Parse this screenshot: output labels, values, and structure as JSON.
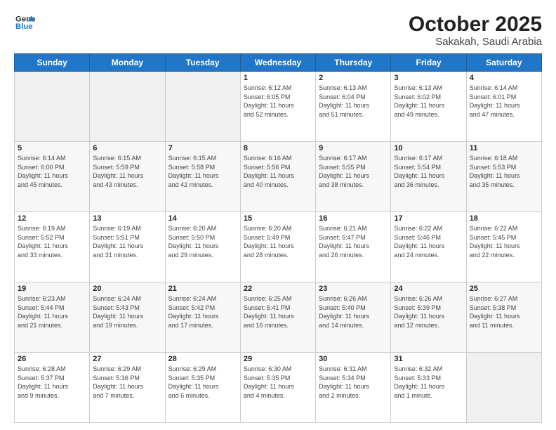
{
  "header": {
    "logo_general": "General",
    "logo_blue": "Blue",
    "month": "October 2025",
    "location": "Sakakah, Saudi Arabia"
  },
  "weekdays": [
    "Sunday",
    "Monday",
    "Tuesday",
    "Wednesday",
    "Thursday",
    "Friday",
    "Saturday"
  ],
  "weeks": [
    [
      {
        "date": "",
        "info": ""
      },
      {
        "date": "",
        "info": ""
      },
      {
        "date": "",
        "info": ""
      },
      {
        "date": "1",
        "info": "Sunrise: 6:12 AM\nSunset: 6:05 PM\nDaylight: 11 hours\nand 52 minutes."
      },
      {
        "date": "2",
        "info": "Sunrise: 6:13 AM\nSunset: 6:04 PM\nDaylight: 11 hours\nand 51 minutes."
      },
      {
        "date": "3",
        "info": "Sunrise: 6:13 AM\nSunset: 6:02 PM\nDaylight: 11 hours\nand 49 minutes."
      },
      {
        "date": "4",
        "info": "Sunrise: 6:14 AM\nSunset: 6:01 PM\nDaylight: 11 hours\nand 47 minutes."
      }
    ],
    [
      {
        "date": "5",
        "info": "Sunrise: 6:14 AM\nSunset: 6:00 PM\nDaylight: 11 hours\nand 45 minutes."
      },
      {
        "date": "6",
        "info": "Sunrise: 6:15 AM\nSunset: 5:59 PM\nDaylight: 11 hours\nand 43 minutes."
      },
      {
        "date": "7",
        "info": "Sunrise: 6:15 AM\nSunset: 5:58 PM\nDaylight: 11 hours\nand 42 minutes."
      },
      {
        "date": "8",
        "info": "Sunrise: 6:16 AM\nSunset: 5:56 PM\nDaylight: 11 hours\nand 40 minutes."
      },
      {
        "date": "9",
        "info": "Sunrise: 6:17 AM\nSunset: 5:55 PM\nDaylight: 11 hours\nand 38 minutes."
      },
      {
        "date": "10",
        "info": "Sunrise: 6:17 AM\nSunset: 5:54 PM\nDaylight: 11 hours\nand 36 minutes."
      },
      {
        "date": "11",
        "info": "Sunrise: 6:18 AM\nSunset: 5:53 PM\nDaylight: 11 hours\nand 35 minutes."
      }
    ],
    [
      {
        "date": "12",
        "info": "Sunrise: 6:19 AM\nSunset: 5:52 PM\nDaylight: 11 hours\nand 33 minutes."
      },
      {
        "date": "13",
        "info": "Sunrise: 6:19 AM\nSunset: 5:51 PM\nDaylight: 11 hours\nand 31 minutes."
      },
      {
        "date": "14",
        "info": "Sunrise: 6:20 AM\nSunset: 5:50 PM\nDaylight: 11 hours\nand 29 minutes."
      },
      {
        "date": "15",
        "info": "Sunrise: 6:20 AM\nSunset: 5:49 PM\nDaylight: 11 hours\nand 28 minutes."
      },
      {
        "date": "16",
        "info": "Sunrise: 6:21 AM\nSunset: 5:47 PM\nDaylight: 11 hours\nand 26 minutes."
      },
      {
        "date": "17",
        "info": "Sunrise: 6:22 AM\nSunset: 5:46 PM\nDaylight: 11 hours\nand 24 minutes."
      },
      {
        "date": "18",
        "info": "Sunrise: 6:22 AM\nSunset: 5:45 PM\nDaylight: 11 hours\nand 22 minutes."
      }
    ],
    [
      {
        "date": "19",
        "info": "Sunrise: 6:23 AM\nSunset: 5:44 PM\nDaylight: 11 hours\nand 21 minutes."
      },
      {
        "date": "20",
        "info": "Sunrise: 6:24 AM\nSunset: 5:43 PM\nDaylight: 11 hours\nand 19 minutes."
      },
      {
        "date": "21",
        "info": "Sunrise: 6:24 AM\nSunset: 5:42 PM\nDaylight: 11 hours\nand 17 minutes."
      },
      {
        "date": "22",
        "info": "Sunrise: 6:25 AM\nSunset: 5:41 PM\nDaylight: 11 hours\nand 16 minutes."
      },
      {
        "date": "23",
        "info": "Sunrise: 6:26 AM\nSunset: 5:40 PM\nDaylight: 11 hours\nand 14 minutes."
      },
      {
        "date": "24",
        "info": "Sunrise: 6:26 AM\nSunset: 5:39 PM\nDaylight: 11 hours\nand 12 minutes."
      },
      {
        "date": "25",
        "info": "Sunrise: 6:27 AM\nSunset: 5:38 PM\nDaylight: 11 hours\nand 11 minutes."
      }
    ],
    [
      {
        "date": "26",
        "info": "Sunrise: 6:28 AM\nSunset: 5:37 PM\nDaylight: 11 hours\nand 9 minutes."
      },
      {
        "date": "27",
        "info": "Sunrise: 6:29 AM\nSunset: 5:36 PM\nDaylight: 11 hours\nand 7 minutes."
      },
      {
        "date": "28",
        "info": "Sunrise: 6:29 AM\nSunset: 5:35 PM\nDaylight: 11 hours\nand 6 minutes."
      },
      {
        "date": "29",
        "info": "Sunrise: 6:30 AM\nSunset: 5:35 PM\nDaylight: 11 hours\nand 4 minutes."
      },
      {
        "date": "30",
        "info": "Sunrise: 6:31 AM\nSunset: 5:34 PM\nDaylight: 11 hours\nand 2 minutes."
      },
      {
        "date": "31",
        "info": "Sunrise: 6:32 AM\nSunset: 5:33 PM\nDaylight: 11 hours\nand 1 minute."
      },
      {
        "date": "",
        "info": ""
      }
    ]
  ]
}
